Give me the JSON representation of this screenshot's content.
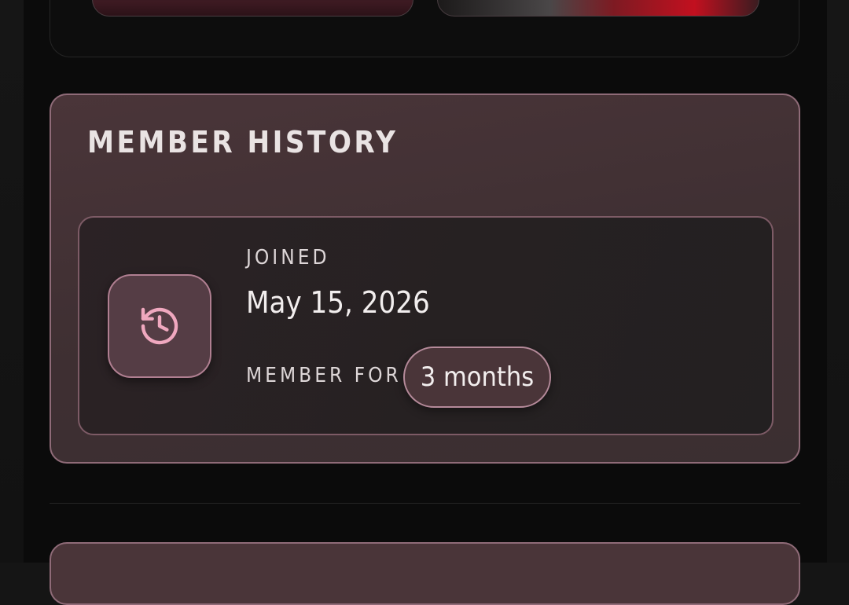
{
  "member_history": {
    "title": "MEMBER HISTORY",
    "joined_label": "JOINED",
    "joined_date": "May 15, 2026",
    "member_for_label": "MEMBER FOR",
    "member_for_value": "3 months",
    "icon": "history-icon"
  },
  "colors": {
    "accent": "#f0a8bf",
    "card_border": "#8f6b78",
    "card_background": "#3e2f32",
    "page_background": "#0b0b0b"
  }
}
